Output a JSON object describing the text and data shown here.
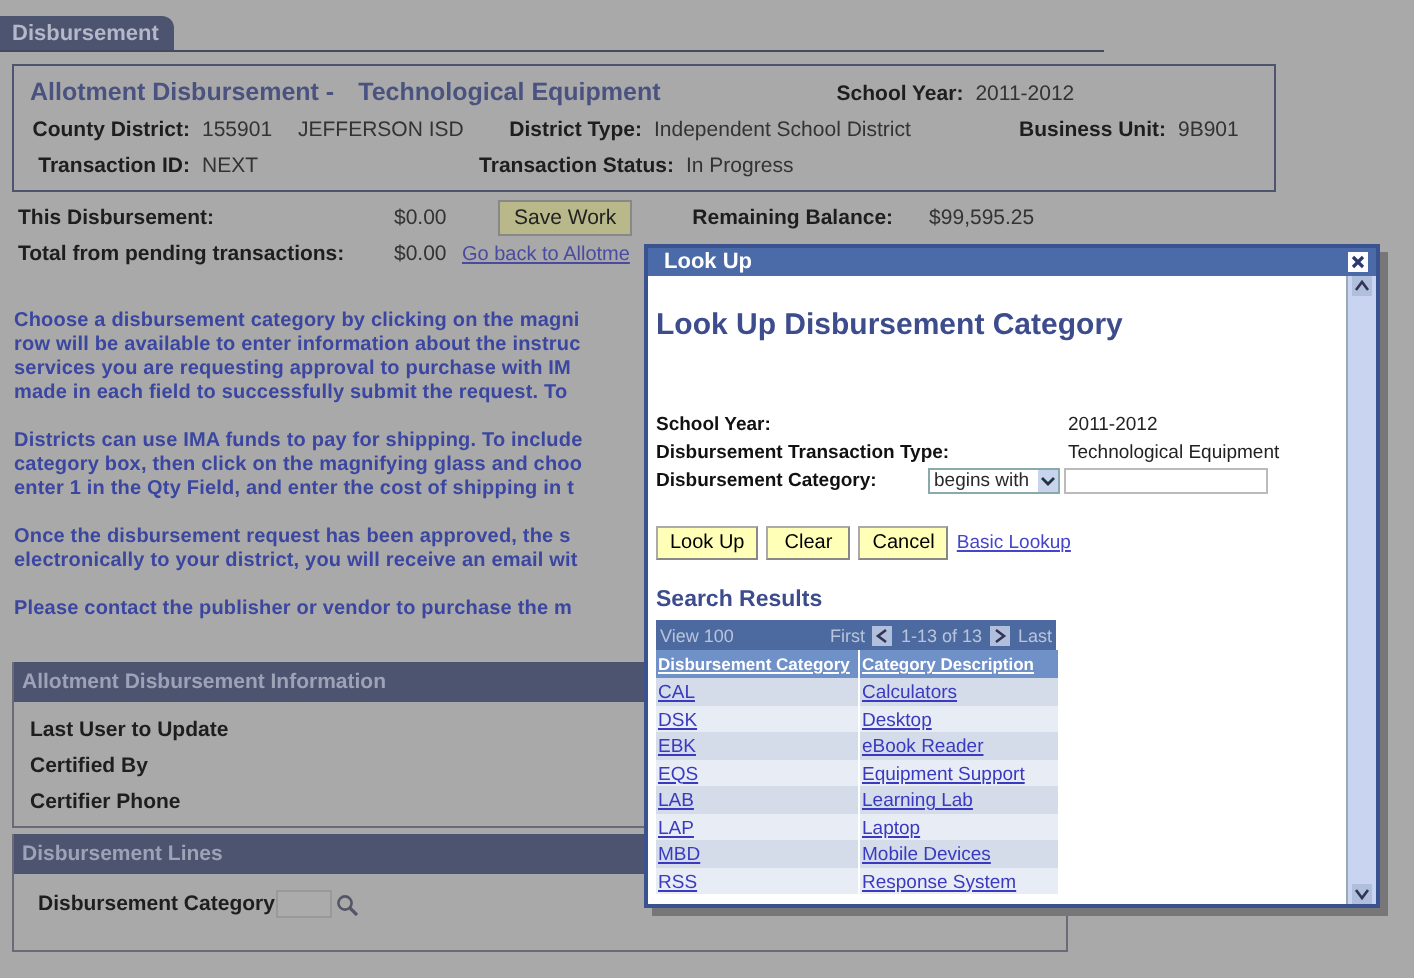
{
  "tab": {
    "label": "Disbursement",
    "selected": true
  },
  "header": {
    "title": "Allotment Disbursement -",
    "subtitle": "Technological Equipment",
    "school_year": {
      "label": "School Year:",
      "value": "2011-2012"
    },
    "county_district": {
      "label": "County District:",
      "value": "155901",
      "name": "JEFFERSON ISD"
    },
    "district_type": {
      "label": "District Type:",
      "value": "Independent School District"
    },
    "business_unit": {
      "label": "Business Unit:",
      "value": "9B901"
    },
    "transaction_id": {
      "label": "Transaction ID:",
      "value": "NEXT"
    },
    "transaction_status": {
      "label": "Transaction Status:",
      "value": "In Progress"
    }
  },
  "totals": {
    "this_disbursement": {
      "label": "This Disbursement:",
      "value": "$0.00"
    },
    "pending": {
      "label": "Total from pending transactions:",
      "value": "$0.00"
    },
    "save_button": "Save Work",
    "remaining_balance": {
      "label": "Remaining Balance:",
      "value": "$99,595.25"
    },
    "back_link": "Go back to Allotme"
  },
  "instructions": [
    [
      "Choose a disbursement category by clicking on the magni",
      "row will be available to enter information about the instruc",
      "services you are requesting approval to purchase with IM",
      "made in each field to successfully submit the request. To"
    ],
    [
      "Districts can use IMA funds to pay for shipping. To include",
      "category box, then click on the magnifying glass and choo",
      "enter 1 in the Qty Field, and enter the cost of shipping in t"
    ],
    [
      "Once the disbursement request has been approved, the s",
      "electronically to your district, you will receive an email wit"
    ],
    [
      "Please contact the publisher or vendor to purchase the m"
    ]
  ],
  "info_section": {
    "title": "Allotment Disbursement Information",
    "fields": [
      "Last User to Update",
      "Certified By",
      "Certifier Phone"
    ]
  },
  "lines_section": {
    "title": "Disbursement Lines",
    "field_label": "Disbursement Category"
  },
  "modal": {
    "title": "Look Up",
    "heading": "Look Up Disbursement Category",
    "fields": [
      {
        "kind": "text",
        "label": "School Year:",
        "value": "2011-2012"
      },
      {
        "kind": "text",
        "label": "Disbursement Transaction Type:",
        "value": "Technological Equipment"
      },
      {
        "kind": "search",
        "label": "Disbursement Category:",
        "operator": "begins with"
      }
    ],
    "buttons": [
      "Look Up",
      "Clear",
      "Cancel"
    ],
    "basic_link": "Basic Lookup",
    "results_title": "Search Results",
    "grid": {
      "view": "View 100",
      "first": "First",
      "range": "1-13 of 13",
      "last": "Last",
      "columns": [
        "Disbursement Category",
        "Category Description"
      ],
      "rows": [
        [
          "CAL",
          "Calculators"
        ],
        [
          "DSK",
          "Desktop"
        ],
        [
          "EBK",
          "eBook Reader"
        ],
        [
          "EQS",
          "Equipment Support"
        ],
        [
          "LAB",
          "Learning Lab"
        ],
        [
          "LAP",
          "Laptop"
        ],
        [
          "MBD",
          "Mobile Devices"
        ],
        [
          "RSS",
          "Response System"
        ]
      ]
    }
  }
}
